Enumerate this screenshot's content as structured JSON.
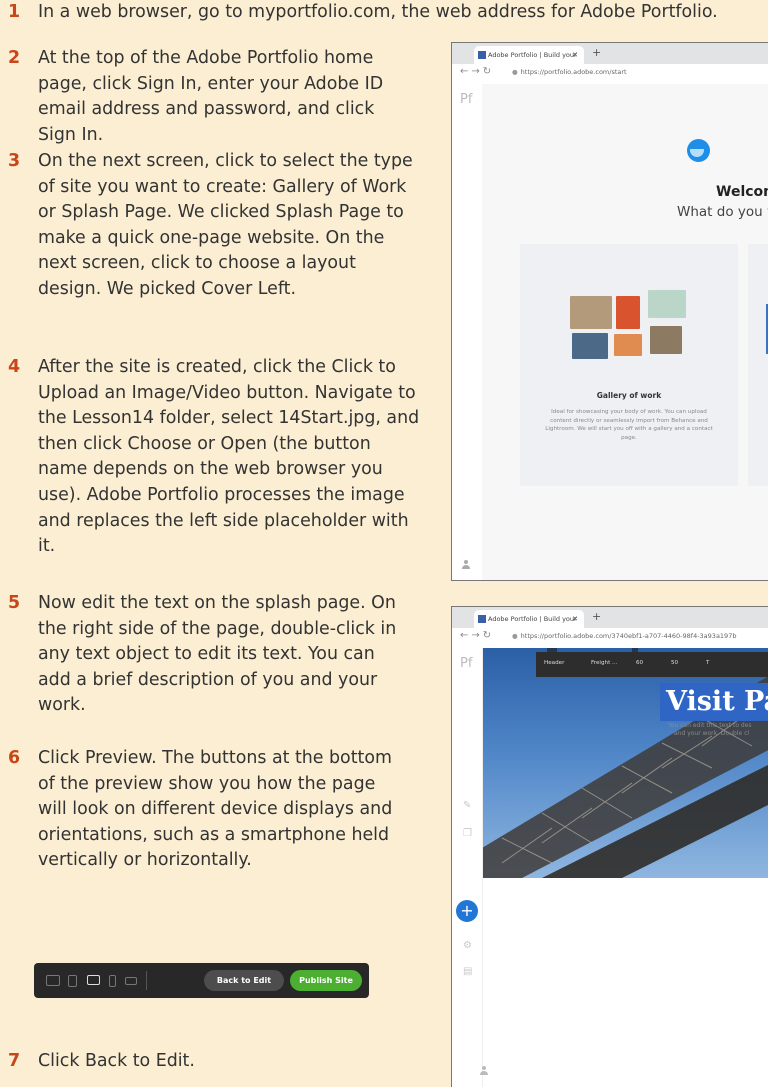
{
  "steps": [
    {
      "num": "1",
      "text": "In a web browser, go to myportfolio.com, the web address for Adobe Portfolio."
    },
    {
      "num": "2",
      "text": "At the top of the Adobe Portfolio home page, click Sign In, enter your Adobe ID email address and password, and click Sign In."
    },
    {
      "num": "3",
      "text": "On the next screen, click to select the type of site you want to create: Gallery of Work or Splash Page. We clicked Splash Page to make a quick one-page website. On the next screen, click to choose a layout design. We picked Cover Left."
    },
    {
      "num": "4",
      "text": "After the site is created, click the Click to Upload an Image/Video button. Navigate to the Lesson14 folder, select 14Start.jpg, and then click Choose or Open (the button name depends on the web browser you use). Adobe Portfolio processes the image and replaces the left side placeholder with it."
    },
    {
      "num": "5",
      "text": "Now edit the text on the splash page. On the right side of the page, double-click in any text object to edit its text. You can add a brief description of you and your work."
    },
    {
      "num": "6",
      "text": "Click Preview. The buttons at the bottom of the preview show you how the page will look on different device displays and orientations, such as a smartphone held vertically or horizontally."
    },
    {
      "num": "7",
      "text": "Click Back to Edit."
    }
  ],
  "preview_bar": {
    "back_label": "Back to Edit",
    "publish_label": "Publish Site",
    "publish_color": "#4caf32",
    "back_color": "#4d4d4d"
  },
  "browser1": {
    "tab_title": "Adobe Portfolio | Build your own",
    "url": "https://portfolio.adobe.com/start",
    "pf": "Pf",
    "welcome": "Welcom",
    "question": "What do you want",
    "card_title": "Gallery of work",
    "card_desc": "Ideal for showcasing your body of work. You can upload content directly or seamlessly import from Behance and Lightroom. We will start you off with a gallery and a contact page."
  },
  "browser2": {
    "tab_title": "Adobe Portfolio | Build your own",
    "url": "https://portfolio.adobe.com/3740ebf1-a707-4460-98f4-3a93a197b",
    "pf": "Pf",
    "toolbar": {
      "style": "Header",
      "font": "Freight ...",
      "size": "60",
      "leading": "50",
      "t": "T"
    },
    "visit_text": "Visit Pa",
    "edit_line1": "You can edit this text to des",
    "edit_line2": "and your work. Double cl"
  },
  "colors": {
    "background": "#fbeed2",
    "step_number": "#c8461a",
    "accent_blue": "#2276d6"
  }
}
